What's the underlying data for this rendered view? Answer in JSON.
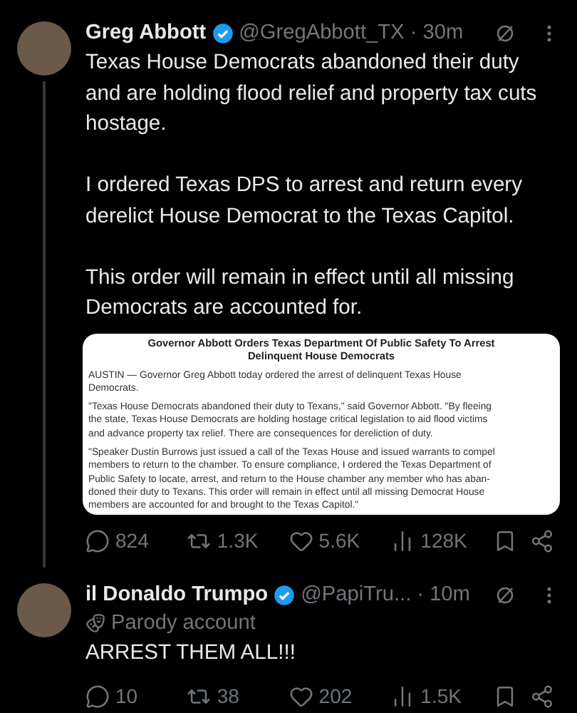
{
  "tweets": [
    {
      "name": "Greg Abbott",
      "verified": true,
      "handle": "@GregAbbott_TX",
      "time": "· 30m",
      "body": [
        "Texas House Democrats abandoned their duty and are holding flood relief and property tax cuts hostage.",
        "I ordered Texas DPS to arrest and return every derelict House Democrat to the Texas Capitol.",
        "This order will remain in effect until all missing Democrats are accounted for."
      ],
      "attachment": {
        "title": [
          "Governor Abbott Orders Texas Department Of Public Safety To Arrest",
          "Delinquent House Democrats"
        ],
        "paragraphs": [
          [
            "AUSTIN — Governor Greg Abbott today ordered the arrest of delinquent Texas House",
            "Democrats."
          ],
          [
            "\"Texas House Democrats abandoned their duty to Texans,\" said Governor Abbott. \"By fleeing",
            "the state, Texas House Democrats are holding hostage critical legislation to aid flood victims",
            "and advance property tax relief. There are consequences for dereliction of duty."
          ],
          [
            "\"Speaker Dustin Burrows just issued a call of the Texas House and issued warrants to compel",
            "members to return to the chamber. To ensure compliance, I ordered the Texas Department of",
            "Public Safety to locate, arrest, and return to the House chamber any member who has aban-",
            "doned their duty to Texans. This order will remain in effect until all missing Democrat House",
            "members are accounted for and brought to the Texas Capitol.\""
          ]
        ]
      },
      "actions": [
        {
          "kind": "reply",
          "count": "824"
        },
        {
          "kind": "repost",
          "count": "1.3K"
        },
        {
          "kind": "like",
          "count": "5.6K"
        },
        {
          "kind": "views",
          "count": "128K"
        },
        {
          "kind": "bookmark"
        },
        {
          "kind": "share"
        }
      ]
    },
    {
      "name": "il Donaldo Trumpo",
      "verified": true,
      "handle": "@PapiTru...",
      "time": "· 10m",
      "parody_label": "Parody account",
      "body": [
        "ARREST THEM ALL!!!"
      ],
      "actions": [
        {
          "kind": "reply",
          "count": "10"
        },
        {
          "kind": "repost",
          "count": "38"
        },
        {
          "kind": "like",
          "count": "202"
        },
        {
          "kind": "views",
          "count": "1.5K"
        },
        {
          "kind": "bookmark"
        },
        {
          "kind": "share"
        }
      ]
    }
  ]
}
